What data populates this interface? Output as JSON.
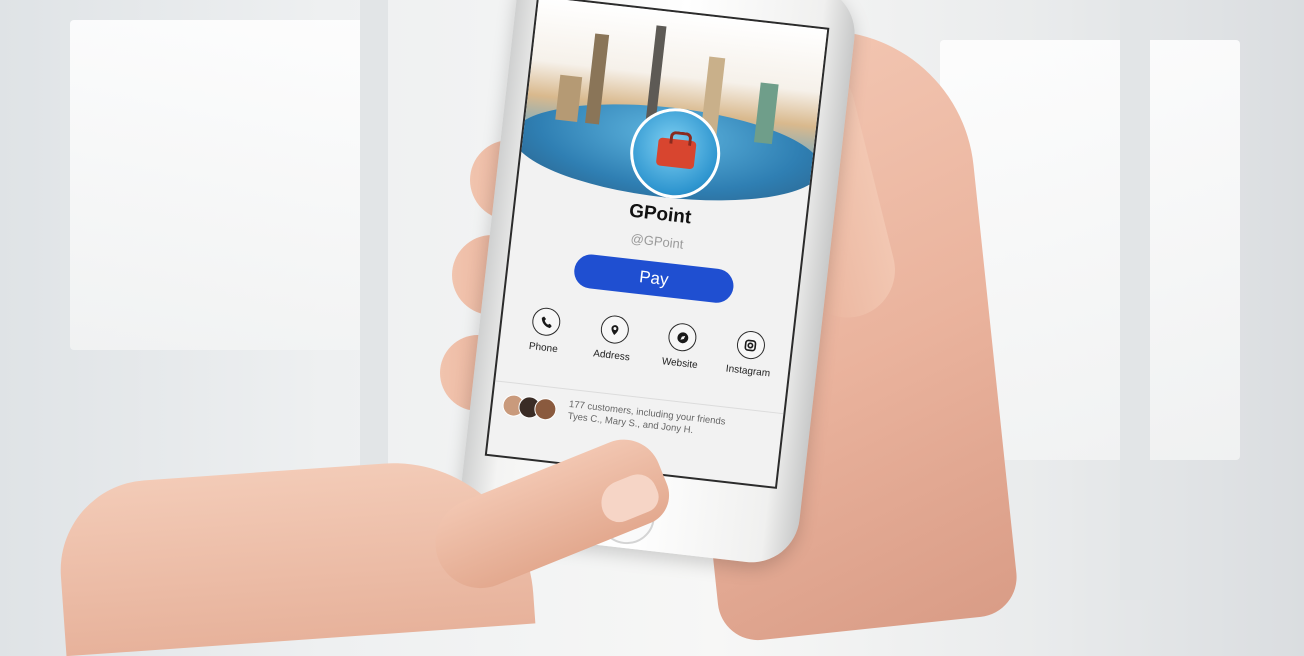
{
  "profile": {
    "name": "GPoint",
    "handle": "@GPoint"
  },
  "pay_button": {
    "label": "Pay",
    "color": "#1f4fd1"
  },
  "actions": [
    {
      "label": "Phone",
      "icon": "phone-icon"
    },
    {
      "label": "Address",
      "icon": "location-pin-icon"
    },
    {
      "label": "Website",
      "icon": "compass-icon"
    },
    {
      "label": "Instagram",
      "icon": "instagram-icon"
    }
  ],
  "customers": {
    "line1": "177 customers, including your friends",
    "line2": "Tyes C., Mary S., and Jony H."
  }
}
